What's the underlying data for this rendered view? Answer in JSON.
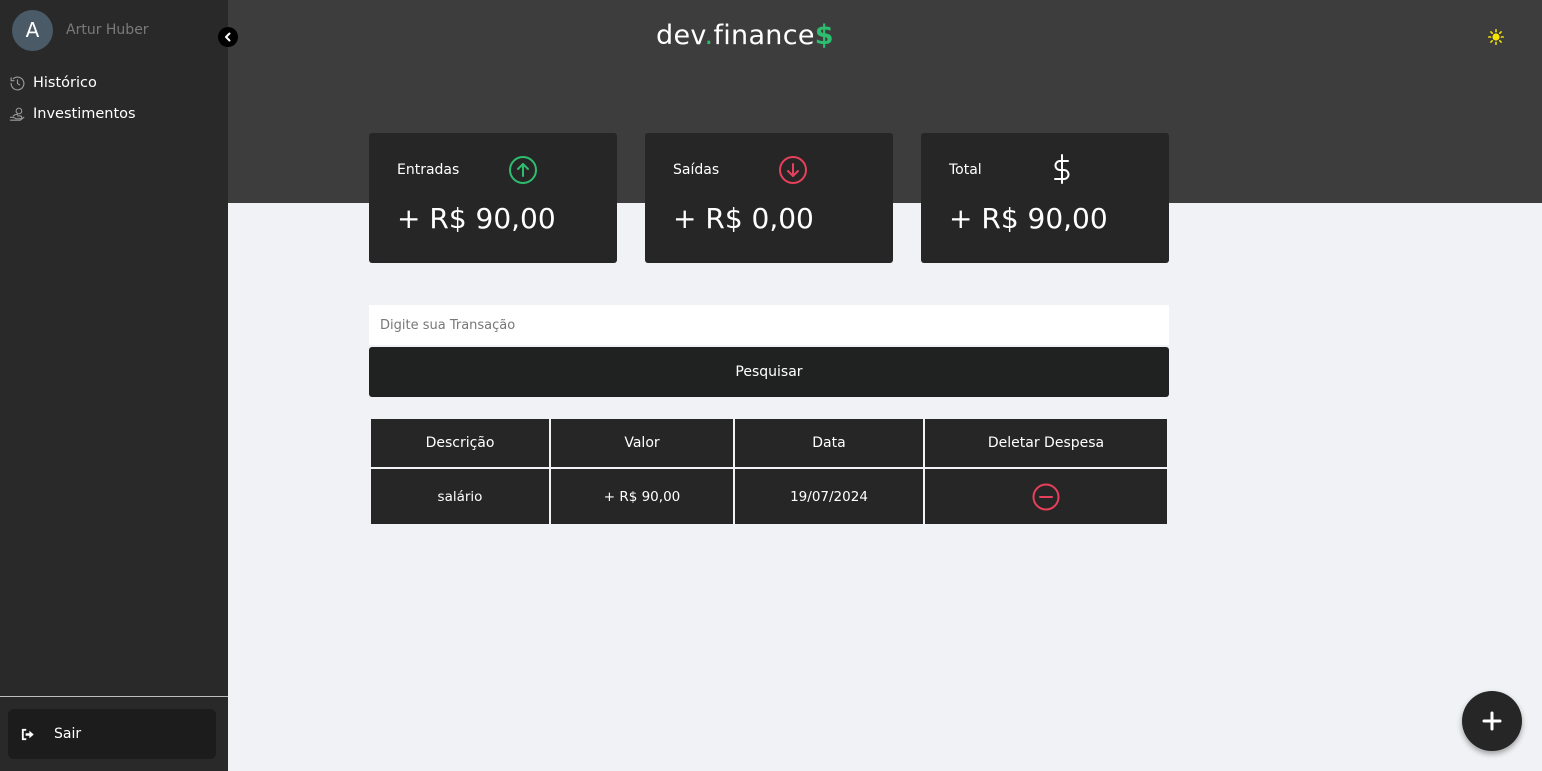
{
  "sidebar": {
    "avatar_initial": "A",
    "user_name": "Artur Huber",
    "items": [
      {
        "label": "Histórico",
        "icon": "history-icon"
      },
      {
        "label": "Investimentos",
        "icon": "investment-icon"
      }
    ],
    "logout_label": "Sair"
  },
  "header": {
    "logo_part1": "dev",
    "logo_dot": ".",
    "logo_part2": "finance",
    "logo_dollar": "$"
  },
  "cards": {
    "entradas": {
      "label": "Entradas",
      "value": "+ R$ 90,00",
      "icon": "arrow-up-circle-icon",
      "color": "#2dbd6e"
    },
    "saidas": {
      "label": "Saídas",
      "value": "+ R$ 0,00",
      "icon": "arrow-down-circle-icon",
      "color": "#e83f5b"
    },
    "total": {
      "label": "Total",
      "value": "+ R$ 90,00",
      "icon": "dollar-sign-icon",
      "color": "#ffffff"
    }
  },
  "search": {
    "placeholder": "Digite sua Transação",
    "value": "",
    "button_label": "Pesquisar"
  },
  "table": {
    "headers": [
      "Descrição",
      "Valor",
      "Data",
      "Deletar Despesa"
    ],
    "rows": [
      {
        "descricao": "salário",
        "valor": "+ R$ 90,00",
        "data": "19/07/2024"
      }
    ]
  },
  "colors": {
    "income": "#2dbd6e",
    "expense": "#e83f5b",
    "header_bg": "#3d3d3d",
    "sidebar_bg": "#292929",
    "theme_icon": "#f5e400"
  }
}
